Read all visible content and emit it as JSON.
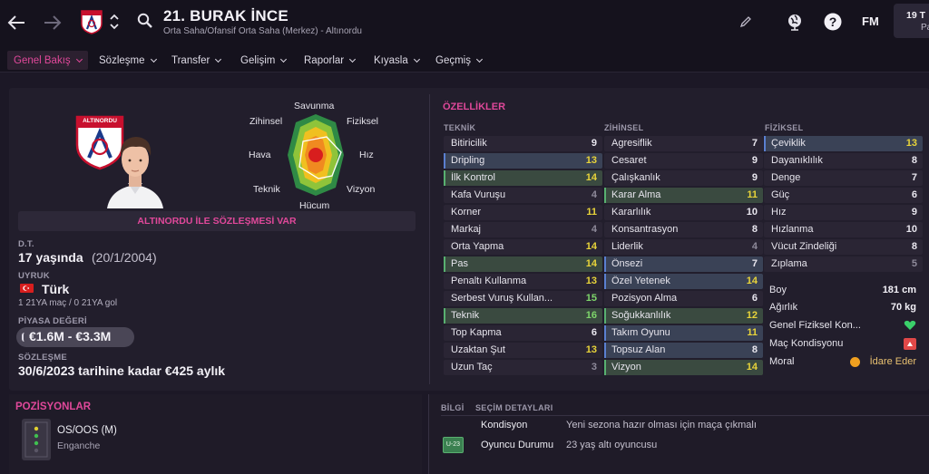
{
  "header": {
    "player_title": "21. BURAK İNCE",
    "subtitle": "Orta Saha/Ofansif Orta Saha (Merkez) - Altınordu",
    "fm_label": "FM",
    "date_line1": "19 T",
    "date_line2": "Pa"
  },
  "nav": {
    "tabs": [
      "Genel Bakış",
      "Sözleşme",
      "Transfer",
      "Gelişim",
      "Raporlar",
      "Kıyasla",
      "Geçmiş"
    ]
  },
  "profile": {
    "contract_banner": "ALTINORDU İLE SÖZLEŞMESİ VAR",
    "dob_label": "D.T.",
    "age": "17 yaşında",
    "dob": "(20/1/2004)",
    "nationality_label": "UYRUK",
    "nationality": "Türk",
    "caps": "1 21YA maç / 0 21YA gol",
    "value_label": "PİYASA DEĞERİ",
    "value": "€1.6M - €3.3M",
    "contract_label": "SÖZLEŞME",
    "contract": "30/6/2023 tarihine kadar €425 aylık",
    "club_badge_text": "ALTINORDU"
  },
  "radar": {
    "labels": [
      "Savunma",
      "Fiziksel",
      "Hız",
      "Vizyon",
      "Hücum",
      "Teknik",
      "Hava",
      "Zihinsel"
    ]
  },
  "attributes": {
    "title": "ÖZELLİKLER",
    "technical_header": "TEKNİK",
    "mental_header": "ZİHİNSEL",
    "physical_header": "FİZİKSEL",
    "technical": [
      {
        "name": "Bitiricilik",
        "value": "9"
      },
      {
        "name": "Dripling",
        "value": "13"
      },
      {
        "name": "İlk Kontrol",
        "value": "14"
      },
      {
        "name": "Kafa Vuruşu",
        "value": "4"
      },
      {
        "name": "Korner",
        "value": "11"
      },
      {
        "name": "Markaj",
        "value": "4"
      },
      {
        "name": "Orta Yapma",
        "value": "14"
      },
      {
        "name": "Pas",
        "value": "14"
      },
      {
        "name": "Penaltı Kullanma",
        "value": "13"
      },
      {
        "name": "Serbest Vuruş Kullan...",
        "value": "15"
      },
      {
        "name": "Teknik",
        "value": "16"
      },
      {
        "name": "Top Kapma",
        "value": "6"
      },
      {
        "name": "Uzaktan Şut",
        "value": "13"
      },
      {
        "name": "Uzun Taç",
        "value": "3"
      }
    ],
    "mental": [
      {
        "name": "Agresiflik",
        "value": "7"
      },
      {
        "name": "Cesaret",
        "value": "9"
      },
      {
        "name": "Çalışkanlık",
        "value": "9"
      },
      {
        "name": "Karar Alma",
        "value": "11"
      },
      {
        "name": "Kararlılık",
        "value": "10"
      },
      {
        "name": "Konsantrasyon",
        "value": "8"
      },
      {
        "name": "Liderlik",
        "value": "4"
      },
      {
        "name": "Önsezi",
        "value": "7"
      },
      {
        "name": "Özel Yetenek",
        "value": "14"
      },
      {
        "name": "Pozisyon Alma",
        "value": "6"
      },
      {
        "name": "Soğukkanlılık",
        "value": "12"
      },
      {
        "name": "Takım Oyunu",
        "value": "11"
      },
      {
        "name": "Topsuz Alan",
        "value": "8"
      },
      {
        "name": "Vizyon",
        "value": "14"
      }
    ],
    "physical": [
      {
        "name": "Çeviklik",
        "value": "13"
      },
      {
        "name": "Dayanıklılık",
        "value": "8"
      },
      {
        "name": "Denge",
        "value": "7"
      },
      {
        "name": "Güç",
        "value": "6"
      },
      {
        "name": "Hız",
        "value": "9"
      },
      {
        "name": "Hızlanma",
        "value": "10"
      },
      {
        "name": "Vücut Zindeliği",
        "value": "8"
      },
      {
        "name": "Zıplama",
        "value": "5"
      }
    ],
    "extra": [
      {
        "name": "Boy",
        "value": "181 cm"
      },
      {
        "name": "Ağırlık",
        "value": "70 kg"
      },
      {
        "name": "Genel Fiziksel Kon...",
        "value": ""
      },
      {
        "name": "Maç Kondisyonu",
        "value": ""
      },
      {
        "name": "Moral",
        "value": "İdare Eder"
      }
    ]
  },
  "positions": {
    "title": "POZİSYONLAR",
    "position": "OS/OOS (M)",
    "role": "Enganche"
  },
  "selection": {
    "info_header": "BİLGİ",
    "details_header": "SEÇİM DETAYLARI",
    "rows": [
      {
        "label": "Kondisyon",
        "value": "Yeni sezona hazır olması için maça çıkmalı"
      },
      {
        "label": "Oyuncu Durumu",
        "value": "23 yaş altı oyuncusu"
      }
    ],
    "u23_badge": "U-23"
  },
  "colors": {
    "accent": "#e0489a",
    "rating_yellow": "#e8d43a",
    "rating_green": "#7ed66b",
    "highlight_blue": "#3a4256",
    "highlight_green": "#3a4a40"
  }
}
